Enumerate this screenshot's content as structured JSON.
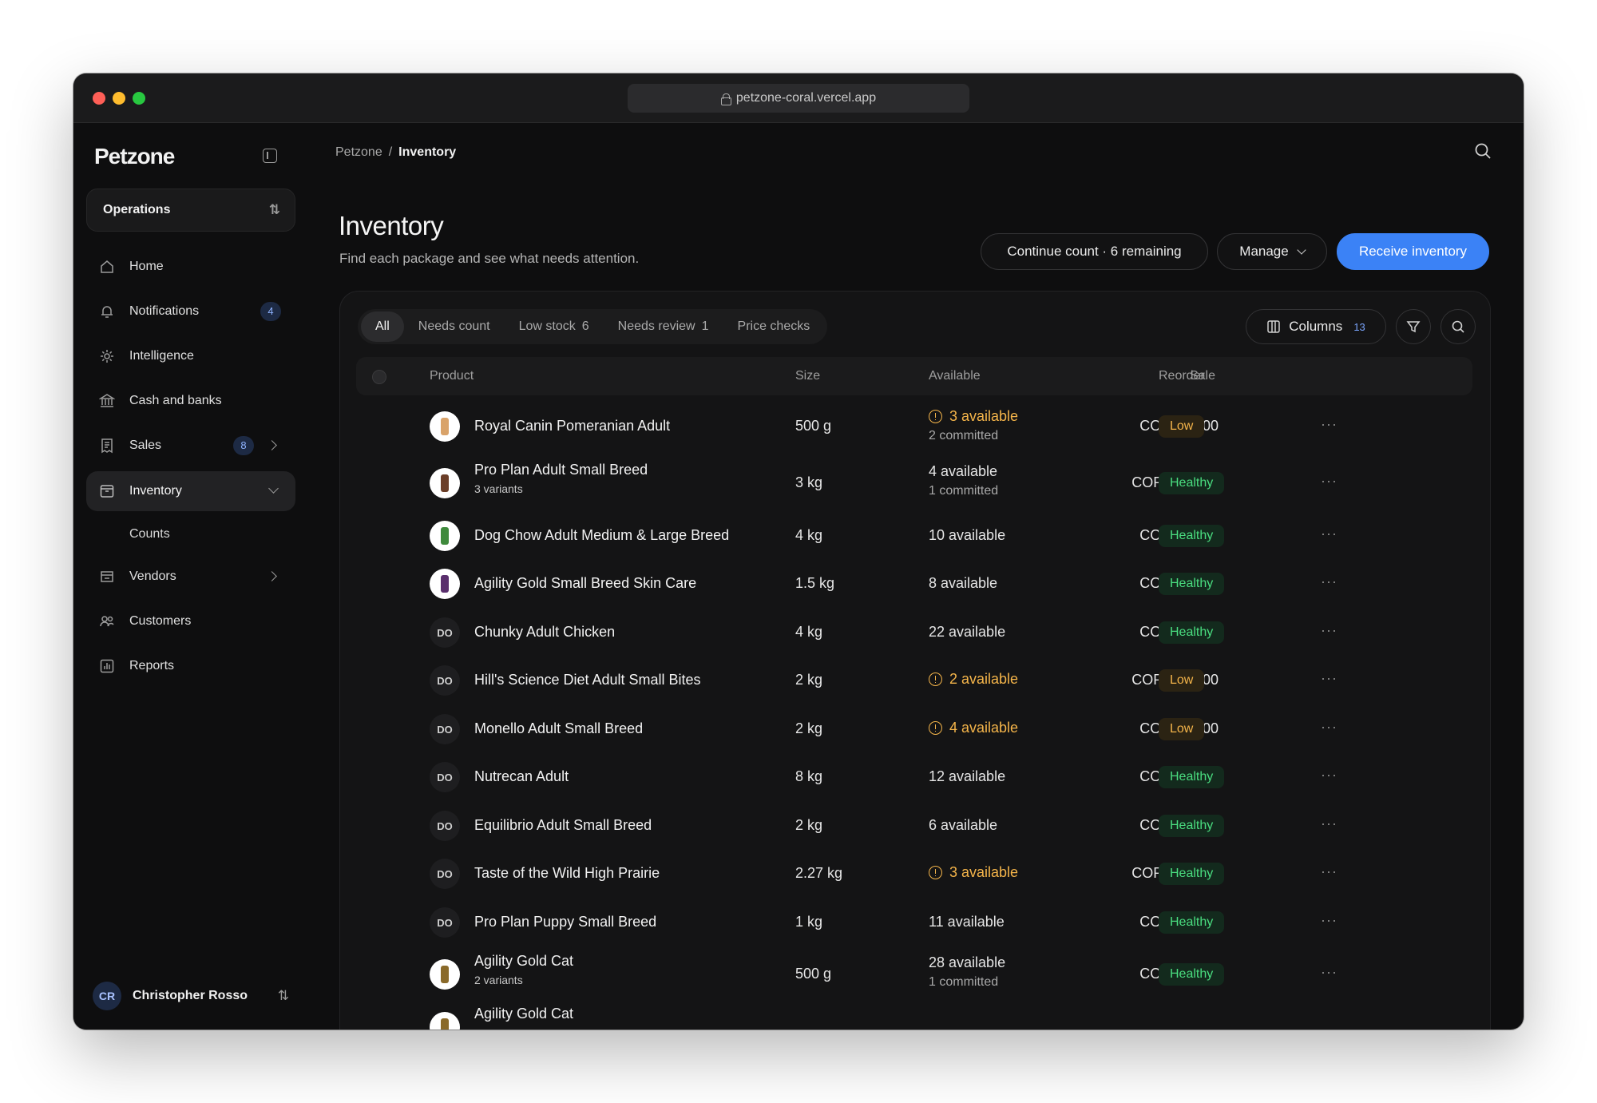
{
  "browser": {
    "url": "petzone-coral.vercel.app"
  },
  "sidebar": {
    "brand": "Petzone",
    "workspace": "Operations",
    "items": [
      {
        "label": "Home",
        "icon": "home-icon"
      },
      {
        "label": "Notifications",
        "icon": "bell-icon",
        "badge": "4"
      },
      {
        "label": "Intelligence",
        "icon": "gear-icon"
      },
      {
        "label": "Cash and banks",
        "icon": "bank-icon"
      },
      {
        "label": "Sales",
        "icon": "receipt-icon",
        "badge": "8"
      },
      {
        "label": "Inventory",
        "icon": "box-icon"
      },
      {
        "label": "Counts"
      },
      {
        "label": "Vendors",
        "icon": "store-icon"
      },
      {
        "label": "Customers",
        "icon": "users-icon"
      },
      {
        "label": "Reports",
        "icon": "chart-icon"
      }
    ],
    "user": {
      "initials": "CR",
      "name": "Christopher Rosso"
    }
  },
  "breadcrumb": {
    "root": "Petzone",
    "separator": "/",
    "current": "Inventory"
  },
  "page": {
    "title": "Inventory",
    "subtitle": "Find each package and see what needs attention.",
    "actions": {
      "continue": "Continue count · 6 remaining",
      "manage": "Manage",
      "receive": "Receive inventory"
    }
  },
  "filters": {
    "tabs": [
      {
        "label": "All",
        "count": ""
      },
      {
        "label": "Needs count",
        "count": ""
      },
      {
        "label": "Low stock",
        "count": "6"
      },
      {
        "label": "Needs review",
        "count": "1"
      },
      {
        "label": "Price checks",
        "count": ""
      }
    ],
    "columns_label": "Columns",
    "columns_count": "13"
  },
  "table": {
    "headers": {
      "product": "Product",
      "size": "Size",
      "available": "Available",
      "sale": "Sale",
      "reorder": "Reorder"
    },
    "rows": [
      {
        "name": "Royal Canin Pomeranian Adult",
        "thumb": "image",
        "size": "500 g",
        "available": "3 available",
        "committed": "2 committed",
        "sale": "COP 39,000",
        "reorder": "Low"
      },
      {
        "name": "Pro Plan Adult Small Breed",
        "variants": "3 variants",
        "thumb": "image",
        "size": "3 kg",
        "available": "4 available",
        "committed": "1 committed",
        "sale": "COP 132,900",
        "reorder": "Healthy"
      },
      {
        "name": "Dog Chow Adult Medium & Large Breed",
        "thumb": "image",
        "size": "4 kg",
        "available": "10 available",
        "sale": "COP 72,900",
        "reorder": "Healthy"
      },
      {
        "name": "Agility Gold Small Breed Skin Care",
        "thumb": "image",
        "size": "1.5 kg",
        "available": "8 available",
        "sale": "COP 58,500",
        "reorder": "Healthy"
      },
      {
        "name": "Chunky Adult Chicken",
        "thumb": "DO",
        "size": "4 kg",
        "available": "22 available",
        "sale": "COP 56,900",
        "reorder": "Healthy"
      },
      {
        "name": "Hill's Science Diet Adult Small Bites",
        "thumb": "DO",
        "size": "2 kg",
        "available": "2 available",
        "sale": "COP 121,000",
        "reorder": "Low"
      },
      {
        "name": "Monello Adult Small Breed",
        "thumb": "DO",
        "size": "2 kg",
        "available": "4 available",
        "sale": "COP 46,900",
        "reorder": "Low"
      },
      {
        "name": "Nutrecan Adult",
        "thumb": "DO",
        "size": "8 kg",
        "available": "12 available",
        "sale": "COP 79,900",
        "reorder": "Healthy"
      },
      {
        "name": "Equilibrio Adult Small Breed",
        "thumb": "DO",
        "size": "2 kg",
        "available": "6 available",
        "sale": "COP 71,900",
        "reorder": "Healthy"
      },
      {
        "name": "Taste of the Wild High Prairie",
        "thumb": "DO",
        "size": "2.27 kg",
        "available": "3 available",
        "sale": "COP 189,000",
        "reorder": "Healthy"
      },
      {
        "name": "Pro Plan Puppy Small Breed",
        "thumb": "DO",
        "size": "1 kg",
        "available": "11 available",
        "sale": "COP 54,900",
        "reorder": "Healthy"
      },
      {
        "name": "Agility Gold Cat",
        "variants": "2 variants",
        "thumb": "image",
        "size": "500 g",
        "available": "28 available",
        "committed": "1 committed",
        "sale": "COP 16,900",
        "reorder": "Healthy"
      },
      {
        "name": "Agility Gold Cat",
        "thumb": "image"
      }
    ]
  },
  "colors": {
    "accent": "#3b82f6",
    "low": "#f5b54a",
    "healthy": "#4ade80",
    "background": "#0e0e0f"
  }
}
